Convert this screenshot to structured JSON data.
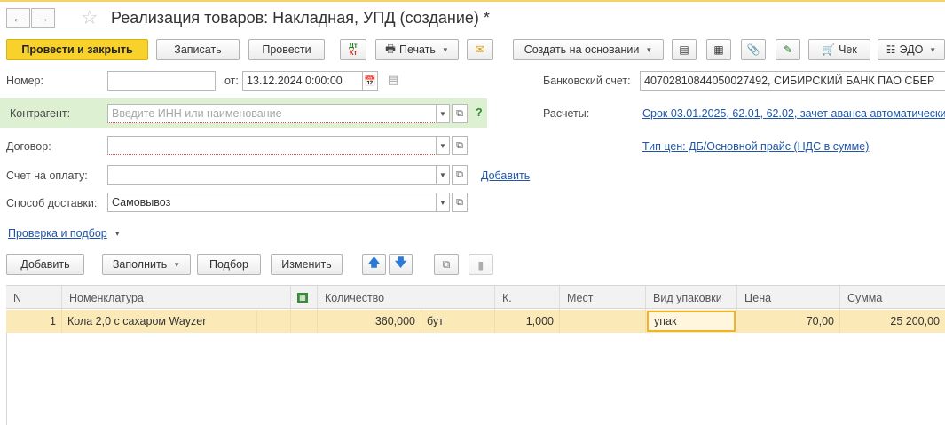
{
  "window": {
    "title": "Реализация товаров: Накладная, УПД (создание) *"
  },
  "nav": {
    "back_icon": "arrow-left-icon",
    "forward_icon": "arrow-right-icon",
    "star_icon": "star-icon"
  },
  "toolbar": {
    "post_close": "Провести и закрыть",
    "write": "Записать",
    "post": "Провести",
    "dtkt_top": "Дт",
    "dtkt_bottom": "Кт",
    "print": "Печать",
    "create_based": "Создать на основании",
    "check": "Чек",
    "edo": "ЭДО"
  },
  "form": {
    "number_label": "Номер:",
    "number_value": "",
    "date_from_label": "от:",
    "date_value": "13.12.2024  0:00:00",
    "bank_label": "Банковский счет:",
    "bank_value": "40702810844050027492, СИБИРСКИЙ БАНК ПАО СБЕР",
    "counterparty_label": "Контрагент:",
    "counterparty_placeholder": "Введите ИНН или наименование",
    "help": "?",
    "settlements_label": "Расчеты:",
    "settlements_link": "Срок 03.01.2025, 62.01, 62.02, зачет аванса автоматически",
    "contract_label": "Договор:",
    "price_type_link": "Тип цен: ДБ/Основной прайс (НДС в сумме)",
    "invoice_label": "Счет на оплату:",
    "add_link": "Добавить",
    "delivery_label": "Способ доставки:",
    "delivery_value": "Самовывоз",
    "check_link": "Проверка и подбор",
    "check_link_caret": "▾"
  },
  "table_toolbar": {
    "add": "Добавить",
    "fill": "Заполнить",
    "pick": "Подбор",
    "change": "Изменить"
  },
  "table": {
    "headers": {
      "n": "N",
      "item": "Номенклатура",
      "qty": "Количество",
      "k": "К.",
      "places": "Мест",
      "pack": "Вид упаковки",
      "price": "Цена",
      "sum": "Сумма"
    },
    "rows": [
      {
        "n": "1",
        "item": "Кола 2,0 с сахаром Wayzer",
        "qty": "360,000",
        "unit": "бут",
        "k": "1,000",
        "places": "",
        "pack": "упак",
        "price": "70,00",
        "sum": "25 200,00"
      }
    ]
  },
  "colors": {
    "accent_yellow": "#f8d12a",
    "counterparty_band": "#ddf0d2",
    "selected_row": "#fbeab7",
    "link": "#1f56a8",
    "required_underline": "#e24a4a"
  }
}
